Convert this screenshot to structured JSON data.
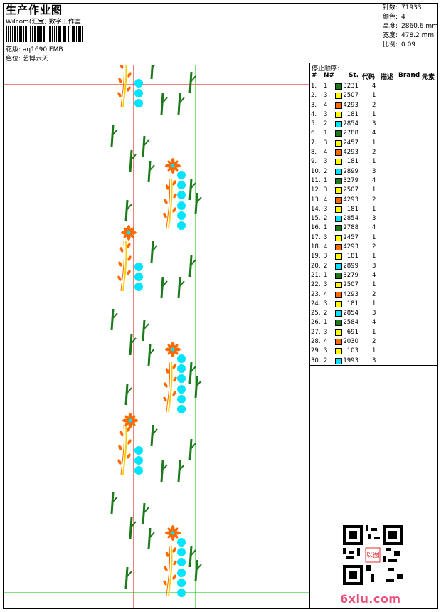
{
  "header": {
    "title": "生产作业图",
    "company": "Wilcom(汇宝) 数字工作室",
    "design_file_label": "花版:",
    "design_file": "aq1690.EMB",
    "color_label": "色位:",
    "color_name": "艺博云天"
  },
  "stats": [
    {
      "label": "针数:",
      "value": "71933"
    },
    {
      "label": "颜色:",
      "value": "4"
    },
    {
      "label": "高度:",
      "value": "2860.6 mm"
    },
    {
      "label": "宽度:",
      "value": "478.2 mm"
    },
    {
      "label": "比例:",
      "value": "0.09"
    }
  ],
  "table": {
    "heading": "停止顺序:",
    "columns": [
      "#",
      "N#",
      "St.",
      "代码",
      "描述",
      "Brand",
      "元素"
    ]
  },
  "palette": {
    "dark_green": "#1c7a1c",
    "yellow": "#ffff00",
    "orange": "#ff6a00",
    "cyan": "#00e5ff",
    "red_guide": "#e00000",
    "green_guide": "#00c000"
  },
  "stops": [
    {
      "n": "1.",
      "needle": "1",
      "color": "#1c7a1c",
      "code": "3231",
      "el": "4"
    },
    {
      "n": "2.",
      "needle": "3",
      "color": "#ffff00",
      "code": "2507",
      "el": "1"
    },
    {
      "n": "3.",
      "needle": "4",
      "color": "#ff6a00",
      "code": "4293",
      "el": "2"
    },
    {
      "n": "4.",
      "needle": "3",
      "color": "#ffff00",
      "code": "181",
      "el": "1"
    },
    {
      "n": "5.",
      "needle": "2",
      "color": "#00e5ff",
      "code": "2854",
      "el": "3"
    },
    {
      "n": "6.",
      "needle": "1",
      "color": "#1c7a1c",
      "code": "2788",
      "el": "4"
    },
    {
      "n": "7.",
      "needle": "3",
      "color": "#ffff00",
      "code": "2457",
      "el": "1"
    },
    {
      "n": "8.",
      "needle": "4",
      "color": "#ff6a00",
      "code": "4293",
      "el": "2"
    },
    {
      "n": "9.",
      "needle": "3",
      "color": "#ffff00",
      "code": "181",
      "el": "1"
    },
    {
      "n": "10.",
      "needle": "2",
      "color": "#00e5ff",
      "code": "2899",
      "el": "3"
    },
    {
      "n": "11.",
      "needle": "1",
      "color": "#1c7a1c",
      "code": "3279",
      "el": "4"
    },
    {
      "n": "12.",
      "needle": "3",
      "color": "#ffff00",
      "code": "2507",
      "el": "1"
    },
    {
      "n": "13.",
      "needle": "4",
      "color": "#ff6a00",
      "code": "4293",
      "el": "2"
    },
    {
      "n": "14.",
      "needle": "3",
      "color": "#ffff00",
      "code": "181",
      "el": "1"
    },
    {
      "n": "15.",
      "needle": "2",
      "color": "#00e5ff",
      "code": "2854",
      "el": "3"
    },
    {
      "n": "16.",
      "needle": "1",
      "color": "#1c7a1c",
      "code": "2788",
      "el": "4"
    },
    {
      "n": "17.",
      "needle": "3",
      "color": "#ffff00",
      "code": "2457",
      "el": "1"
    },
    {
      "n": "18.",
      "needle": "4",
      "color": "#ff6a00",
      "code": "4293",
      "el": "2"
    },
    {
      "n": "19.",
      "needle": "3",
      "color": "#ffff00",
      "code": "181",
      "el": "1"
    },
    {
      "n": "20.",
      "needle": "2",
      "color": "#00e5ff",
      "code": "2899",
      "el": "3"
    },
    {
      "n": "21.",
      "needle": "1",
      "color": "#1c7a1c",
      "code": "3279",
      "el": "4"
    },
    {
      "n": "22.",
      "needle": "3",
      "color": "#ffff00",
      "code": "2507",
      "el": "1"
    },
    {
      "n": "23.",
      "needle": "4",
      "color": "#ff6a00",
      "code": "4293",
      "el": "2"
    },
    {
      "n": "24.",
      "needle": "3",
      "color": "#ffff00",
      "code": "181",
      "el": "1"
    },
    {
      "n": "25.",
      "needle": "2",
      "color": "#00e5ff",
      "code": "2854",
      "el": "3"
    },
    {
      "n": "26.",
      "needle": "1",
      "color": "#1c7a1c",
      "code": "2584",
      "el": "4"
    },
    {
      "n": "27.",
      "needle": "3",
      "color": "#ffff00",
      "code": "691",
      "el": "1"
    },
    {
      "n": "28.",
      "needle": "4",
      "color": "#ff6a00",
      "code": "2030",
      "el": "2"
    },
    {
      "n": "29.",
      "needle": "3",
      "color": "#ffff00",
      "code": "103",
      "el": "1"
    },
    {
      "n": "30.",
      "needle": "2",
      "color": "#00e5ff",
      "code": "1993",
      "el": "3"
    }
  ],
  "qr_stamp": "以图",
  "watermark": "6xiu.com"
}
